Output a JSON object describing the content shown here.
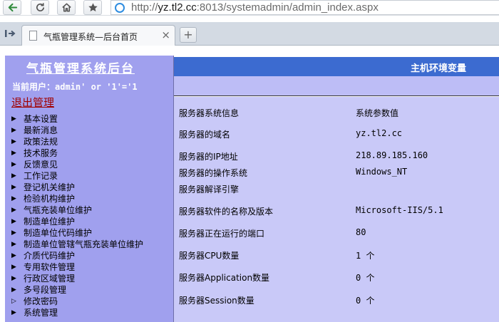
{
  "browser": {
    "url": {
      "prefix": "http://",
      "host": "yz.tl2.cc",
      "rest": ":8013/systemadmin/admin_index.aspx"
    },
    "tab": {
      "title": "气瓶管理系统—后台首页",
      "close_glyph": "×"
    },
    "new_tab_glyph": "+"
  },
  "sidebar": {
    "title": "气瓶管理系统后台",
    "current_user": "当前用户：admin' or '1'='1",
    "logout_label": "退出管理",
    "items": [
      {
        "label": "基本设置"
      },
      {
        "label": "最新消息"
      },
      {
        "label": "政策法规"
      },
      {
        "label": "技术服务"
      },
      {
        "label": "反馈意见"
      },
      {
        "label": "工作记录"
      },
      {
        "label": "登记机关维护"
      },
      {
        "label": "检验机构维护"
      },
      {
        "label": "气瓶充装单位维护"
      },
      {
        "label": "制造单位维护"
      },
      {
        "label": "制造单位代码维护"
      },
      {
        "label": "制造单位管辖气瓶充装单位维护"
      },
      {
        "label": "介质代码维护"
      },
      {
        "label": "专用软件管理"
      },
      {
        "label": "行政区域管理"
      },
      {
        "label": "多号段管理"
      },
      {
        "label": "修改密码",
        "arrow": "▷"
      },
      {
        "label": "系统管理"
      }
    ],
    "arrow_glyph": "▶"
  },
  "main": {
    "section_title": "主机环境变量",
    "rows": [
      {
        "key": "服务器系统信息",
        "value": "系统参数值"
      },
      {
        "key": "服务器的域名",
        "value": "yz.tl2.cc"
      },
      {
        "key": "服务器的IP地址",
        "value": "218.89.185.160"
      },
      {
        "key": "服务器的操作系统",
        "value": "Windows_NT"
      },
      {
        "key": "服务器解译引擎",
        "value": ""
      },
      {
        "key": "服务器软件的名称及版本",
        "value": "Microsoft-IIS/5.1"
      },
      {
        "key": "服务器正在运行的端口",
        "value": "80"
      },
      {
        "key": "服务器CPU数量",
        "value": "1 个"
      },
      {
        "key": "服务器Application数量",
        "value": "0 个"
      },
      {
        "key": "服务器Session数量",
        "value": "0 个"
      }
    ]
  }
}
